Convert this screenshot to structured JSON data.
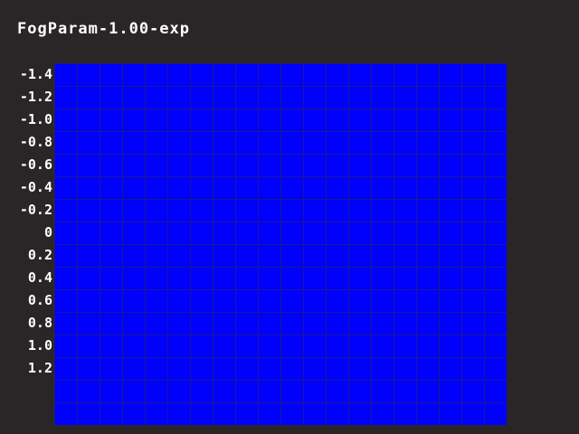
{
  "title": "FogParam-1.00-exp",
  "row_labels": [
    "-1.4",
    "-1.2",
    "-1.0",
    "-0.8",
    "-0.6",
    "-0.4",
    "-0.2",
    "0",
    "0.2",
    "0.4",
    "0.6",
    "0.8",
    "1.0",
    "1.2"
  ],
  "grid": {
    "columns": 20,
    "rows": 16,
    "fill_color": "#0000fd",
    "line_color": "#1a1a8c"
  },
  "background_color": "#2a2627"
}
